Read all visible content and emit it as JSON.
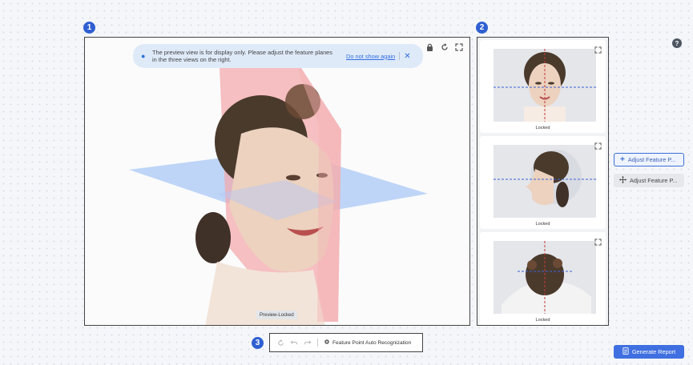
{
  "markers": [
    "1",
    "2",
    "3"
  ],
  "preview": {
    "banner": {
      "message": "The preview view is for display only. Please adjust the feature planes in the three views on the right.",
      "link": "Do not show again",
      "close_icon": "close-icon",
      "pin_icon": "location-pin-icon"
    },
    "toolbar_icons": [
      "lock-icon",
      "rotate-reset-icon",
      "fullscreen-icon"
    ],
    "status_tag": "Preview-Locked"
  },
  "views": [
    {
      "label": "Locked",
      "name": "front-view",
      "expand_icon": "fullscreen-icon"
    },
    {
      "label": "Locked",
      "name": "side-view",
      "expand_icon": "fullscreen-icon"
    },
    {
      "label": "Locked",
      "name": "top-view",
      "expand_icon": "fullscreen-icon"
    }
  ],
  "side_buttons": [
    {
      "label": "Adjust Feature P...",
      "icon": "plus-icon",
      "active": true
    },
    {
      "label": "Adjust Feature P...",
      "icon": "move-icon",
      "active": false
    }
  ],
  "bottom_toolbar": {
    "icons": [
      "reset-icon",
      "undo-icon",
      "redo-icon"
    ],
    "auto_label": "Feature Point Auto Recognization",
    "auto_icon": "auto-recognize-icon"
  },
  "generate_button": {
    "label": "Generate Report",
    "icon": "report-icon"
  },
  "help": "?",
  "colors": {
    "accent": "#3f6fe0",
    "marker": "#2f5fd1",
    "plane_red": "#f4a5a8",
    "plane_blue": "#a9c8f5"
  }
}
